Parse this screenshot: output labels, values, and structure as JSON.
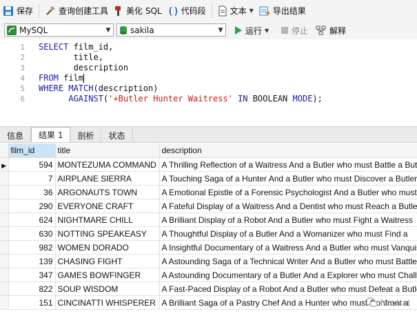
{
  "toolbar1": {
    "save": "保存",
    "query_builder": "查询创建工具",
    "beautify": "美化 SQL",
    "snippet": "代码段",
    "text": "文本",
    "export": "导出结果"
  },
  "toolbar2": {
    "connection": "MySQL",
    "database": "sakila",
    "run": "运行",
    "stop": "停止",
    "explain": "解释"
  },
  "editor": {
    "line_numbers": [
      "1",
      "2",
      "3",
      "4",
      "5",
      "6"
    ]
  },
  "tabs": [
    "信息",
    "结果 1",
    "剖析",
    "状态"
  ],
  "active_tab": 1,
  "grid": {
    "columns": [
      "film_id",
      "title",
      "description"
    ],
    "rows": [
      [
        "594",
        "MONTEZUMA COMMAND",
        "A Thrilling Reflection of a Waitress And a Butler who must Battle a Butler"
      ],
      [
        "7",
        "AIRPLANE SIERRA",
        "A Touching Saga of a Hunter And a Butler who must Discover a Butler"
      ],
      [
        "36",
        "ARGONAUTS TOWN",
        "A Emotional Epistle of a Forensic Psychologist And a Butler who must"
      ],
      [
        "290",
        "EVERYONE CRAFT",
        "A Fateful Display of a Waitress And a Dentist who must Reach a Butler"
      ],
      [
        "624",
        "NIGHTMARE CHILL",
        "A Brilliant Display of a Robot And a Butler who must Fight a Waitress"
      ],
      [
        "630",
        "NOTTING SPEAKEASY",
        "A Thoughtful Display of a Butler And a Womanizer who must Find a"
      ],
      [
        "982",
        "WOMEN DORADO",
        "A Insightful Documentary of a Waitress And a Butler who must Vanquish"
      ],
      [
        "139",
        "CHASING FIGHT",
        "A Astounding Saga of a Technical Writer And a Butler who must Battle"
      ],
      [
        "347",
        "GAMES BOWFINGER",
        "A Astounding Documentary of a Butler And a Explorer who must Challenge"
      ],
      [
        "822",
        "SOUP WISDOM",
        "A Fast-Paced Display of a Robot And a Butler who must Defeat a Butler"
      ],
      [
        "151",
        "CINCINATTI WHISPERER",
        "A Brilliant Saga of a Pastry Chef And a Hunter who must Confront a"
      ]
    ]
  },
  "watermark": "Navicat",
  "colors": {
    "keyword": "#1a1aa6",
    "string": "#c41a16",
    "run_green": "#2ea043"
  }
}
